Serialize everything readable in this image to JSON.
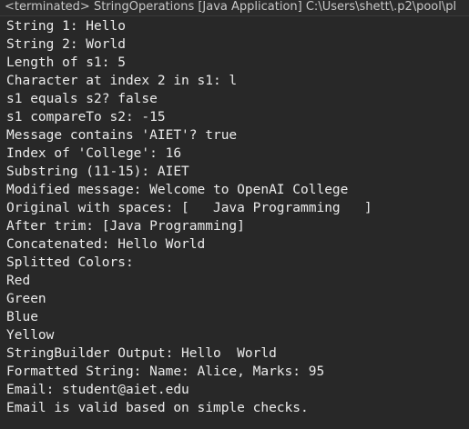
{
  "console": {
    "title": "<terminated> StringOperations [Java Application] C:\\Users\\shett\\.p2\\pool\\pl",
    "lines": [
      "String 1: Hello",
      "String 2: World",
      "Length of s1: 5",
      "Character at index 2 in s1: l",
      "s1 equals s2? false",
      "s1 compareTo s2: -15",
      "Message contains 'AIET'? true",
      "Index of 'College': 16",
      "Substring (11-15): AIET",
      "Modified message: Welcome to OpenAI College",
      "Original with spaces: [   Java Programming   ]",
      "After trim: [Java Programming]",
      "Concatenated: Hello World",
      "Splitted Colors:",
      "Red",
      "Green",
      "Blue",
      "Yellow",
      "StringBuilder Output: Hello  World",
      "Formatted String: Name: Alice, Marks: 95",
      "Email: student@aiet.edu",
      "Email is valid based on simple checks."
    ]
  },
  "colors": {
    "background": "#282828",
    "text": "#ebebeb",
    "title_text": "#c8c8c8"
  }
}
